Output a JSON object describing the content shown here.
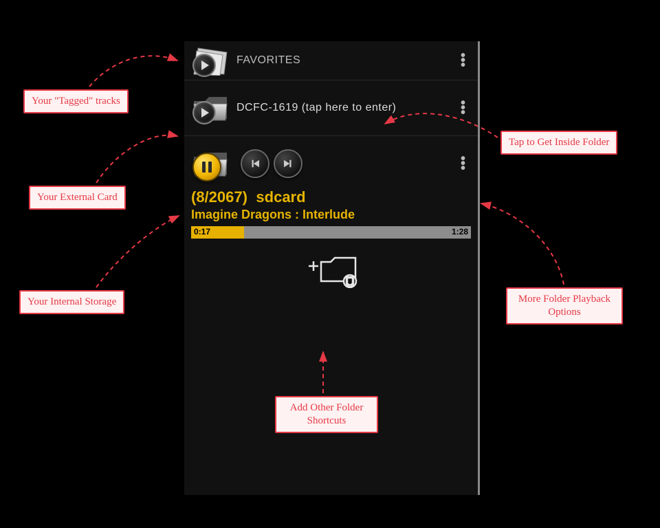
{
  "favorites": {
    "header_label": "FAVORITES"
  },
  "folder1": {
    "label": "DCFC-1619 (tap here to enter)"
  },
  "nowplaying": {
    "counter": "(8/2067)",
    "name": "sdcard",
    "track": "Imagine Dragons : Interlude",
    "time_elapsed": "0:17",
    "time_total": "1:28",
    "progress_pct": 19
  },
  "callouts": {
    "tagged": "Your \"Tagged\" tracks",
    "external": "Your External Card",
    "internal": "Your Internal Storage",
    "tap_folder": "Tap to Get Inside Folder",
    "more_options": "More Folder Playback Options",
    "add_shortcut": "Add Other Folder Shortcuts"
  }
}
